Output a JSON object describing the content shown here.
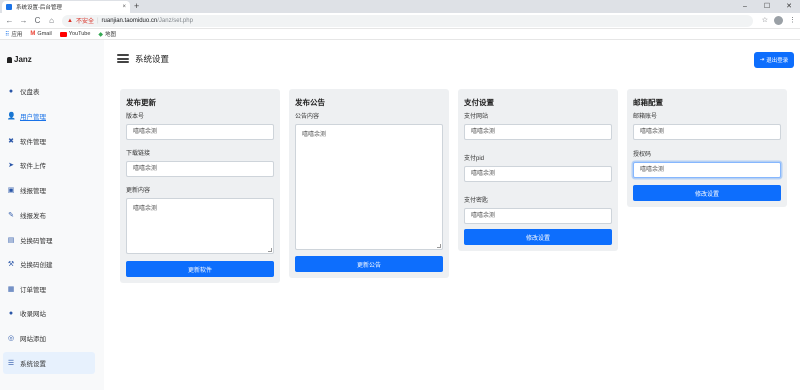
{
  "browser": {
    "tab_title": "系统设置-后台管理",
    "tab_close": "×",
    "new_tab": "+",
    "window": {
      "minimize": "–",
      "maximize": "☐",
      "close": "✕"
    },
    "nav": {
      "back": "←",
      "forward": "→",
      "reload": "C",
      "home": "⌂"
    },
    "insecure_label": "不安全",
    "url_host": "ruanjian.taomiduo.cn",
    "url_path": "/Janz/set.php",
    "bookmarks": {
      "apps": "应用",
      "gmail": "Gmail",
      "youtube": "YouTube",
      "maps": "地图"
    }
  },
  "app": {
    "brand": "Janz",
    "page_title": "系统设置",
    "logout_label": "退出登录"
  },
  "sidebar": {
    "items": [
      {
        "label": "仪盘表",
        "icon": "●"
      },
      {
        "label": "用户管理",
        "icon": "👤"
      },
      {
        "label": "软件管理",
        "icon": "✖"
      },
      {
        "label": "软件上传",
        "icon": "➤"
      },
      {
        "label": "线报管理",
        "icon": "▣"
      },
      {
        "label": "线报发布",
        "icon": "✎"
      },
      {
        "label": "兑换码管理",
        "icon": "▤"
      },
      {
        "label": "兑换码创建",
        "icon": "⚒"
      },
      {
        "label": "订单管理",
        "icon": "▦"
      },
      {
        "label": "收录网站",
        "icon": "●"
      },
      {
        "label": "网站添加",
        "icon": "◎"
      },
      {
        "label": "系统设置",
        "icon": "☰"
      }
    ]
  },
  "cards": {
    "release": {
      "title": "发布更新",
      "version_label": "版本号",
      "version_value": "嘻嘻余测",
      "download_label": "下载链接",
      "download_value": "嘻嘻余测",
      "content_label": "更新内容",
      "content_value": "嘻嘻余测",
      "button": "更新软件"
    },
    "notice": {
      "title": "发布公告",
      "content_label": "公告内容",
      "content_value": "嘻嘻余测",
      "button": "更新公告"
    },
    "payment": {
      "title": "支付设置",
      "site_label": "支付网站",
      "site_value": "嘻嘻余测",
      "pid_label": "支付pid",
      "pid_value": "嘻嘻余测",
      "key_label": "支付密匙",
      "key_value": "嘻嘻余测",
      "button": "修改设置"
    },
    "mail": {
      "title": "邮箱配置",
      "account_label": "邮箱账号",
      "account_value": "嘻嘻余测",
      "auth_label": "授权码",
      "auth_value": "嘻嘻余测",
      "button": "修改设置"
    }
  },
  "colors": {
    "primary": "#0d6efd",
    "card_bg": "#eef0f2",
    "sidebar_bg": "#f8f9fa"
  }
}
